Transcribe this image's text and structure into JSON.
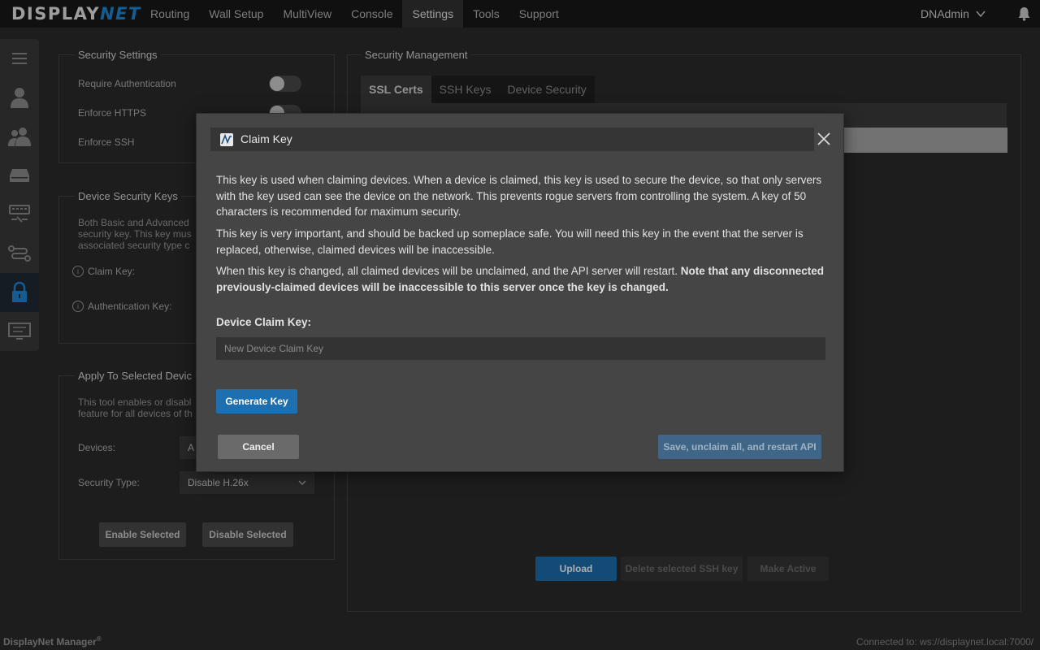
{
  "app": {
    "logo_left": "DISPLAY",
    "logo_right": "NET",
    "nav": [
      "Routing",
      "Wall Setup",
      "MultiView",
      "Console",
      "Settings",
      "Tools",
      "Support"
    ],
    "active_nav": "Settings",
    "user": "DNAdmin"
  },
  "sidebar": {
    "items": [
      "menu-icon",
      "user-icon",
      "users-icon",
      "server-icon",
      "keyboard-icon",
      "routing-icon",
      "lock-icon",
      "monitor-icon"
    ],
    "active": "lock-icon"
  },
  "security_settings": {
    "title": "Security Settings",
    "require_auth": "Require Authentication",
    "enforce_https": "Enforce HTTPS",
    "enforce_ssh": "Enforce SSH"
  },
  "device_keys": {
    "title": "Device Security Keys",
    "desc": [
      "Both Basic and Advanced",
      "security key. This key mus",
      "associated security type c"
    ],
    "claim_key": "Claim Key:",
    "auth_key": "Authentication Key:"
  },
  "apply": {
    "title": "Apply To Selected Devic",
    "desc": [
      "This tool enables or disabl",
      "feature for all devices of th"
    ],
    "devices_label": "Devices:",
    "devices_value": "A",
    "security_type_label": "Security Type:",
    "security_type_value": "Disable H.26x",
    "enable_btn": "Enable Selected",
    "disable_btn": "Disable Selected"
  },
  "security_management": {
    "title": "Security Management",
    "tabs": [
      "SSL Certs",
      "SSH Keys",
      "Device Security"
    ],
    "active_tab": "SSL Certs",
    "upload_btn": "Upload",
    "delete_btn": "Delete selected SSH key",
    "make_active_btn": "Make Active"
  },
  "modal": {
    "title": "Claim Key",
    "para1": "This key is used when claiming devices. When a device is claimed, this key is used to secure the device, so that only servers with the key used can see the device on the network. This prevents rogue servers from controlling the system. A key of 50 characters is recommended for maximum security.",
    "para2": "This key is very important, and should be backed up someplace safe. You will need this key in the event that the server is replaced, otherwise, claimed devices will be inaccessible.",
    "para3_plain": "When this key is changed, all claimed devices will be unclaimed, and the API server will restart. ",
    "para3_bold": "Note that any disconnected previously-claimed devices will be inaccessible to this server once the key is changed.",
    "field_label": "Device Claim Key:",
    "field_placeholder": "New Device Claim Key",
    "field_value": "",
    "generate_btn": "Generate Key",
    "cancel_btn": "Cancel",
    "save_btn": "Save, unclaim all, and restart API"
  },
  "footer": {
    "app_name": "DisplayNet Manager",
    "reg_mark": "®",
    "connection": "Connected to: ws://displaynet.local:7000/"
  },
  "colors": {
    "accent": "#1d6fb0",
    "background": "#2b2b2b",
    "topbar": "#181818",
    "modal": "#454545"
  }
}
